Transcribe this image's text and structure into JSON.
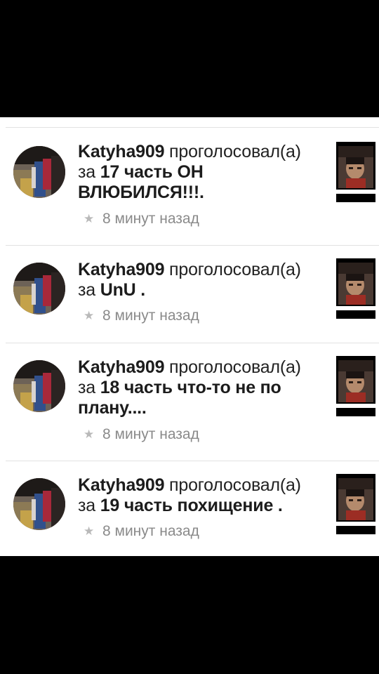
{
  "feed": {
    "items": [
      {
        "username": "Katyha909",
        "action": "проголосовал(а)",
        "prep": "за",
        "story": "17 часть ОН ВЛЮБИЛСЯ!!!.",
        "time": "8 минут назад"
      },
      {
        "username": "Katyha909",
        "action": "проголосовал(а)",
        "prep": "за",
        "story": "UnU .",
        "time": "8 минут назад"
      },
      {
        "username": "Katyha909",
        "action": "проголосовал(а)",
        "prep": "за",
        "story": "18 часть что-то не по плану....",
        "time": "8 минут назад"
      },
      {
        "username": "Katyha909",
        "action": "проголосовал(а)",
        "prep": "за",
        "story": "19 часть похищение .",
        "time": "8 минут назад"
      }
    ],
    "star_icon": "star-icon"
  },
  "colors": {
    "background": "#ffffff",
    "letterbox": "#000000",
    "divider": "#e2e2e2",
    "text": "#1c1c1c",
    "meta": "#8a8a8a"
  }
}
